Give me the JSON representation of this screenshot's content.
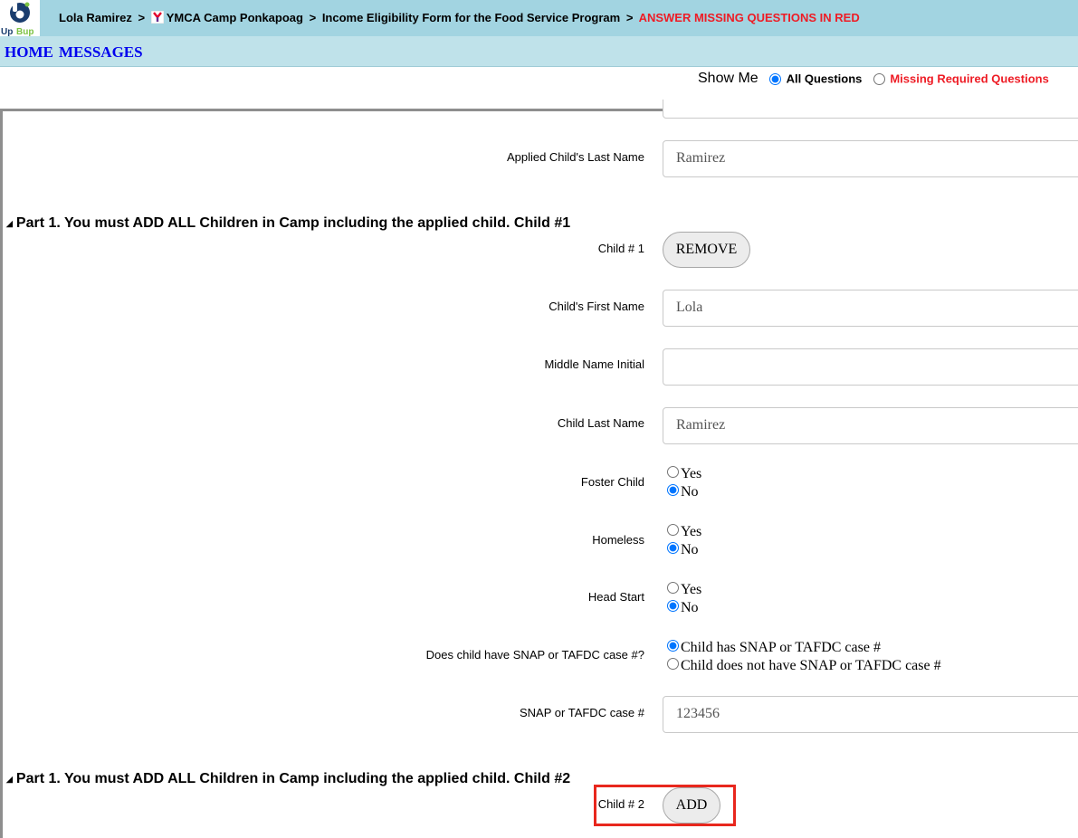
{
  "header": {
    "logo_text": "UpBup",
    "crumb_user": "Lola Ramirez",
    "crumb_sep": ">",
    "crumb_camp": "YMCA Camp Ponkapoag",
    "crumb_form": "Income Eligibility Form for the Food Service Program",
    "crumb_instruction": "ANSWER MISSING QUESTIONS IN RED"
  },
  "nav": {
    "home": "HOME",
    "messages": "MESSAGES"
  },
  "show_me": {
    "label": "Show Me",
    "options": [
      "All Questions",
      "Missing Required Questions"
    ],
    "selected": "All Questions"
  },
  "form": {
    "applied_last_name_label": "Applied Child's Last Name",
    "applied_last_name_value": "Ramirez",
    "child1": {
      "section_title": "Part 1. You must ADD ALL Children in Camp including the applied child. Child #1",
      "child_number_label": "Child # 1",
      "remove_button": "REMOVE",
      "first_name_label": "Child's First Name",
      "first_name_value": "Lola",
      "middle_initial_label": "Middle Name Initial",
      "middle_initial_value": "",
      "last_name_label": "Child Last Name",
      "last_name_value": "Ramirez",
      "foster_label": "Foster Child",
      "homeless_label": "Homeless",
      "headstart_label": "Head Start",
      "yes": "Yes",
      "no": "No",
      "foster_value": "No",
      "homeless_value": "No",
      "headstart_value": "No",
      "snap_question_label": "Does child have SNAP or TAFDC case #?",
      "snap_option_has": "Child has SNAP or TAFDC case #",
      "snap_option_not": "Child does not have SNAP or TAFDC case #",
      "snap_selected": "Child has SNAP or TAFDC case #",
      "case_label": "SNAP or TAFDC case #",
      "case_value": "123456"
    },
    "child2": {
      "section_title": "Part 1. You must ADD ALL Children in Camp including the applied child. Child #2",
      "child_number_label": "Child # 2",
      "add_button": "ADD"
    }
  },
  "colors": {
    "header_bg": "#a2d4e1",
    "nav_bg": "#bfe2ea",
    "alert_red": "#ee1c25",
    "link_blue": "#0000ee",
    "highlight_red": "#e8271d"
  }
}
